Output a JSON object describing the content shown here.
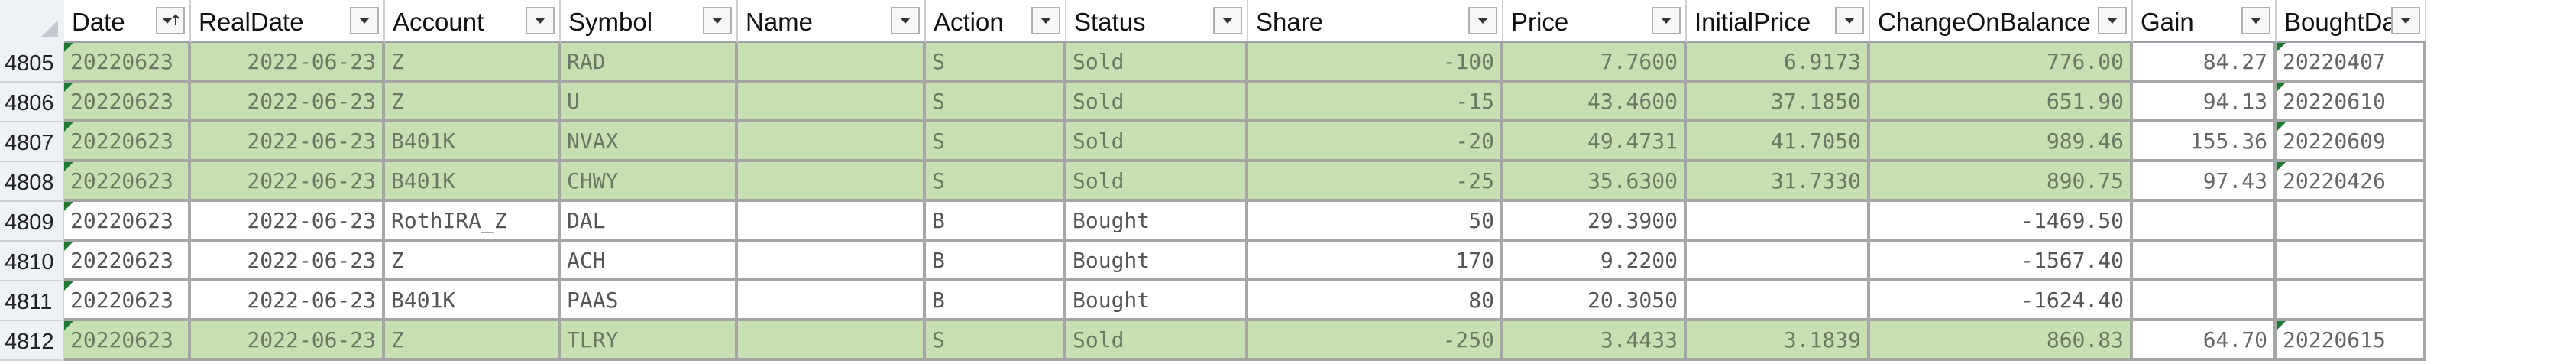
{
  "columns": [
    {
      "key": "date",
      "label": "Date",
      "sorted": true
    },
    {
      "key": "real_date",
      "label": "RealDate"
    },
    {
      "key": "account",
      "label": "Account"
    },
    {
      "key": "symbol",
      "label": "Symbol"
    },
    {
      "key": "name",
      "label": "Name"
    },
    {
      "key": "action",
      "label": "Action"
    },
    {
      "key": "status",
      "label": "Status"
    },
    {
      "key": "share",
      "label": "Share"
    },
    {
      "key": "price",
      "label": "Price"
    },
    {
      "key": "initial_price",
      "label": "InitialPrice"
    },
    {
      "key": "change_on_balance",
      "label": "ChangeOnBalance"
    },
    {
      "key": "gain",
      "label": "Gain"
    },
    {
      "key": "bought_date",
      "label": "BoughtDate"
    }
  ],
  "highlight_color": "#c6e0b4",
  "rows": [
    {
      "row_num": "4805",
      "highlight": true,
      "date": "20220623",
      "real_date": "2022-06-23",
      "account": "Z",
      "symbol": "RAD",
      "name": "",
      "action": "S",
      "status": "Sold",
      "share": "-100",
      "price": "7.7600",
      "initial_price": "6.9173",
      "change_on_balance": "776.00",
      "gain": "84.27",
      "bought_date": "20220407"
    },
    {
      "row_num": "4806",
      "highlight": true,
      "date": "20220623",
      "real_date": "2022-06-23",
      "account": "Z",
      "symbol": "U",
      "name": "",
      "action": "S",
      "status": "Sold",
      "share": "-15",
      "price": "43.4600",
      "initial_price": "37.1850",
      "change_on_balance": "651.90",
      "gain": "94.13",
      "bought_date": "20220610"
    },
    {
      "row_num": "4807",
      "highlight": true,
      "date": "20220623",
      "real_date": "2022-06-23",
      "account": "B401K",
      "symbol": "NVAX",
      "name": "",
      "action": "S",
      "status": "Sold",
      "share": "-20",
      "price": "49.4731",
      "initial_price": "41.7050",
      "change_on_balance": "989.46",
      "gain": "155.36",
      "bought_date": "20220609"
    },
    {
      "row_num": "4808",
      "highlight": true,
      "date": "20220623",
      "real_date": "2022-06-23",
      "account": "B401K",
      "symbol": "CHWY",
      "name": "",
      "action": "S",
      "status": "Sold",
      "share": "-25",
      "price": "35.6300",
      "initial_price": "31.7330",
      "change_on_balance": "890.75",
      "gain": "97.43",
      "bought_date": "20220426"
    },
    {
      "row_num": "4809",
      "highlight": false,
      "date": "20220623",
      "real_date": "2022-06-23",
      "account": "RothIRA_Z",
      "symbol": "DAL",
      "name": "",
      "action": "B",
      "status": "Bought",
      "share": "50",
      "price": "29.3900",
      "initial_price": "",
      "change_on_balance": "-1469.50",
      "gain": "",
      "bought_date": ""
    },
    {
      "row_num": "4810",
      "highlight": false,
      "date": "20220623",
      "real_date": "2022-06-23",
      "account": "Z",
      "symbol": "ACH",
      "name": "",
      "action": "B",
      "status": "Bought",
      "share": "170",
      "price": "9.2200",
      "initial_price": "",
      "change_on_balance": "-1567.40",
      "gain": "",
      "bought_date": ""
    },
    {
      "row_num": "4811",
      "highlight": false,
      "date": "20220623",
      "real_date": "2022-06-23",
      "account": "B401K",
      "symbol": "PAAS",
      "name": "",
      "action": "B",
      "status": "Bought",
      "share": "80",
      "price": "20.3050",
      "initial_price": "",
      "change_on_balance": "-1624.40",
      "gain": "",
      "bought_date": ""
    },
    {
      "row_num": "4812",
      "highlight": true,
      "date": "20220623",
      "real_date": "2022-06-23",
      "account": "Z",
      "symbol": "TLRY",
      "name": "",
      "action": "S",
      "status": "Sold",
      "share": "-250",
      "price": "3.4433",
      "initial_price": "3.1839",
      "change_on_balance": "860.83",
      "gain": "64.70",
      "bought_date": "20220615"
    }
  ]
}
